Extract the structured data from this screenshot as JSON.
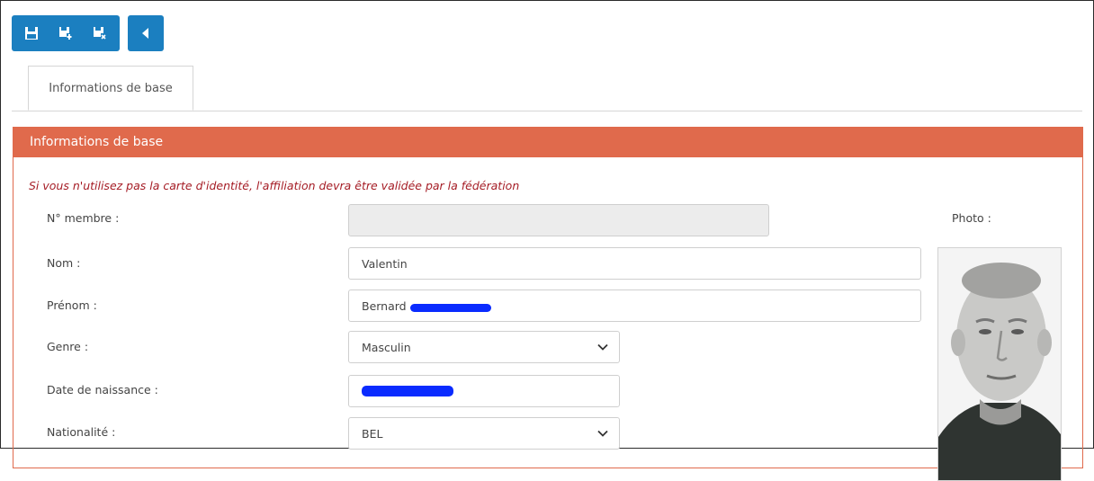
{
  "toolbar": {
    "buttons": [
      {
        "icon": "save-icon"
      },
      {
        "icon": "save-new-icon"
      },
      {
        "icon": "save-close-icon"
      },
      {
        "icon": "back-icon"
      }
    ],
    "accent_color": "#1b7fc0"
  },
  "tabs": [
    {
      "label": "Informations de base"
    }
  ],
  "panel": {
    "title": "Informations de base",
    "header_color": "#e06a4c",
    "notice": "Si vous n'utilisez pas la carte d'identité, l'affiliation devra être validée par la fédération",
    "notice_color": "#a51c25"
  },
  "form": {
    "member_no": {
      "label": "N° membre :",
      "value": ""
    },
    "nom": {
      "label": "Nom :",
      "value": "Valentin"
    },
    "prenom": {
      "label": "Prénom :",
      "value": "Bernard"
    },
    "genre": {
      "label": "Genre :",
      "value": "Masculin"
    },
    "date_naissance": {
      "label": "Date de naissance :",
      "value": ""
    },
    "nationalite": {
      "label": "Nationalité :",
      "value": "BEL"
    }
  },
  "photo": {
    "label": "Photo :"
  }
}
